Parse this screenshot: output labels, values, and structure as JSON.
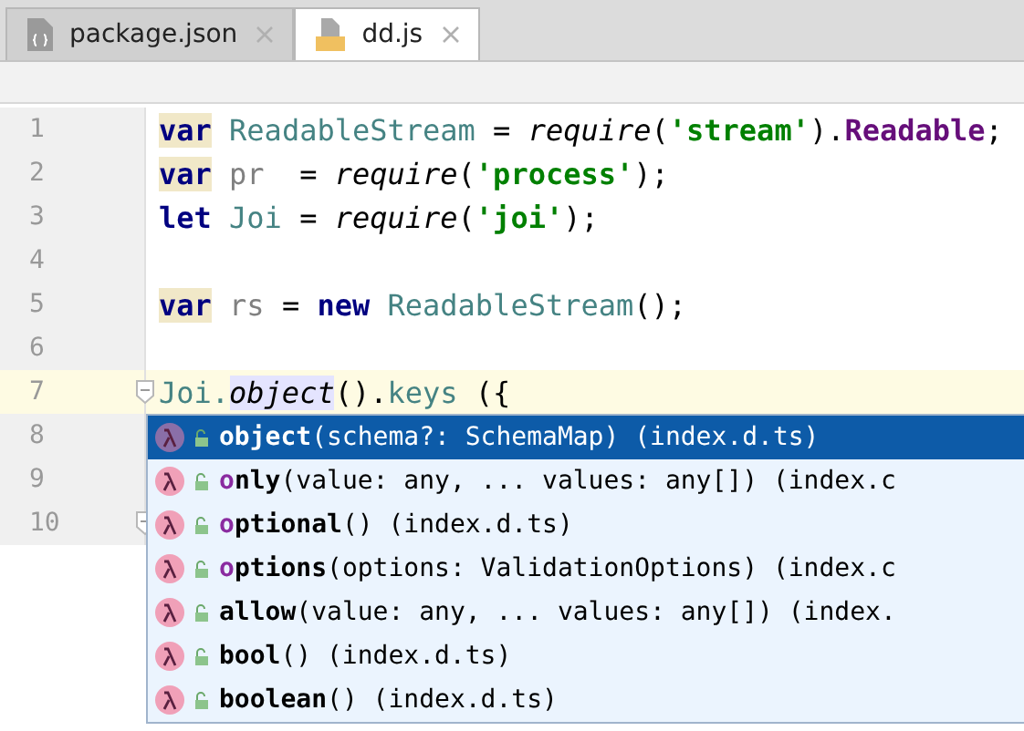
{
  "tabs": [
    {
      "label": "package.json",
      "kind": "json",
      "selected": false
    },
    {
      "label": "dd.js",
      "kind": "js",
      "selected": true
    }
  ],
  "editor": {
    "lines": [
      {
        "number": "1",
        "current": false,
        "tokens": [
          {
            "kind": "kw",
            "text": "var",
            "marked": true
          },
          {
            "kind": "ident",
            "text": " ReadableStream"
          },
          {
            "kind": "plain",
            "text": " = "
          },
          {
            "kind": "fn",
            "text": "require"
          },
          {
            "kind": "plain",
            "text": "("
          },
          {
            "kind": "str",
            "text": "'stream'"
          },
          {
            "kind": "plain",
            "text": ")."
          },
          {
            "kind": "prop",
            "text": "Readable"
          },
          {
            "kind": "plain",
            "text": ";"
          }
        ]
      },
      {
        "number": "2",
        "current": false,
        "tokens": [
          {
            "kind": "kw",
            "text": "var",
            "marked": true
          },
          {
            "kind": "unused",
            "text": " pr"
          },
          {
            "kind": "plain",
            "text": "  = "
          },
          {
            "kind": "fn",
            "text": "require"
          },
          {
            "kind": "plain",
            "text": "("
          },
          {
            "kind": "str",
            "text": "'process'"
          },
          {
            "kind": "plain",
            "text": ");"
          }
        ]
      },
      {
        "number": "3",
        "current": false,
        "tokens": [
          {
            "kind": "kw",
            "text": "let"
          },
          {
            "kind": "ident",
            "text": " Joi"
          },
          {
            "kind": "plain",
            "text": " = "
          },
          {
            "kind": "fn",
            "text": "require"
          },
          {
            "kind": "plain",
            "text": "("
          },
          {
            "kind": "str",
            "text": "'joi'"
          },
          {
            "kind": "plain",
            "text": ");"
          }
        ]
      },
      {
        "number": "4",
        "current": false
      },
      {
        "number": "5",
        "current": false,
        "tokens": [
          {
            "kind": "kw",
            "text": "var",
            "marked": true
          },
          {
            "kind": "unused",
            "text": " rs"
          },
          {
            "kind": "plain",
            "text": " = "
          },
          {
            "kind": "kw",
            "text": "new"
          },
          {
            "kind": "ident",
            "text": " ReadableStream"
          },
          {
            "kind": "plain",
            "text": "();"
          }
        ]
      },
      {
        "number": "6",
        "current": false
      },
      {
        "number": "7",
        "current": true,
        "fold": true,
        "tokens": [
          {
            "kind": "ident",
            "text": "Joi."
          },
          {
            "kind": "fn",
            "text": "object",
            "marked": true
          },
          {
            "kind": "plain",
            "text": "()."
          },
          {
            "kind": "ident",
            "text": "keys"
          },
          {
            "kind": "plain",
            "text": " ({"
          }
        ]
      },
      {
        "number": "8",
        "current": false
      },
      {
        "number": "9",
        "current": false
      },
      {
        "number": "10",
        "current": false,
        "fold": true
      }
    ]
  },
  "completion": {
    "items": [
      {
        "match": "object",
        "signature": "(schema?: SchemaMap) (index.d.ts)",
        "selected": true
      },
      {
        "match": "o",
        "rest": "nly",
        "signature": "(value: any, ... values: any[]) (index.c",
        "selected": false
      },
      {
        "match": "o",
        "rest": "ptional",
        "signature": "() (index.d.ts)",
        "selected": false
      },
      {
        "match": "o",
        "rest": "ptions",
        "signature": "(options: ValidationOptions) (index.c",
        "selected": false
      },
      {
        "rest": "allow",
        "signature": "(value: any, ... values: any[]) (index.",
        "selected": false
      },
      {
        "rest": "bool",
        "signature": "() (index.d.ts)",
        "selected": false
      },
      {
        "rest": "boolean",
        "signature": "() (index.d.ts)",
        "selected": false
      }
    ]
  }
}
